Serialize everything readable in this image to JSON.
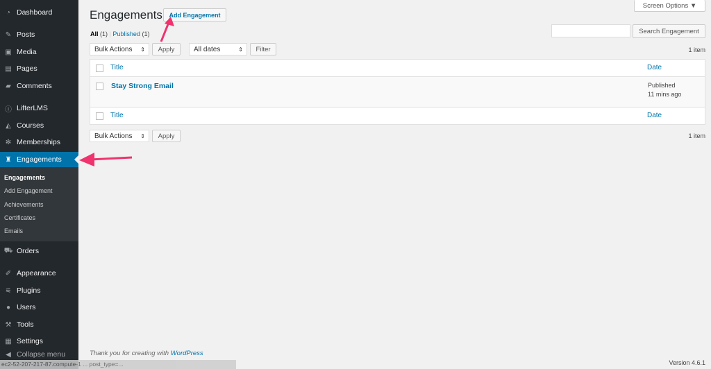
{
  "sidebar": {
    "items": [
      {
        "label": "Dashboard",
        "icon": "dashboard-icon"
      },
      {
        "label": "Posts",
        "icon": "pin-icon"
      },
      {
        "label": "Media",
        "icon": "media-icon"
      },
      {
        "label": "Pages",
        "icon": "pages-icon"
      },
      {
        "label": "Comments",
        "icon": "comment-icon"
      },
      {
        "label": "LifterLMS",
        "icon": "lifterlms-icon"
      },
      {
        "label": "Courses",
        "icon": "graduation-cap-icon"
      },
      {
        "label": "Memberships",
        "icon": "group-icon"
      },
      {
        "label": "Engagements",
        "icon": "award-icon"
      },
      {
        "label": "Orders",
        "icon": "cart-icon"
      },
      {
        "label": "Appearance",
        "icon": "brush-icon"
      },
      {
        "label": "Plugins",
        "icon": "plugin-icon"
      },
      {
        "label": "Users",
        "icon": "user-icon"
      },
      {
        "label": "Tools",
        "icon": "wrench-icon"
      },
      {
        "label": "Settings",
        "icon": "settings-icon"
      },
      {
        "label": "Collapse menu",
        "icon": "collapse-icon"
      }
    ],
    "submenu": [
      "Engagements",
      "Add Engagement",
      "Achievements",
      "Certificates",
      "Emails"
    ]
  },
  "header": {
    "title": "Engagements",
    "add_label": "Add Engagement",
    "screen_options": "Screen Options"
  },
  "filters": {
    "all": "All",
    "all_count": "(1)",
    "sep": "|",
    "published": "Published",
    "published_count": "(1)",
    "bulk": "Bulk Actions",
    "apply": "Apply",
    "dates": "All dates",
    "filter": "Filter",
    "item_count": "1 item",
    "search_button": "Search Engagement",
    "search_value": ""
  },
  "table": {
    "col_title": "Title",
    "col_date": "Date",
    "rows": [
      {
        "title": "Stay Strong Email",
        "status": "Published",
        "time": "11 mins ago"
      }
    ]
  },
  "footer": {
    "thanks": "Thank you for creating with ",
    "wp": "WordPress",
    "version": "Version 4.6.1",
    "status_url": "ec2-52-207-217-87.compute-1 ... post_type=..."
  },
  "colors": {
    "accent": "#0073aa",
    "sidebar": "#23282d",
    "arrow": "#f0326e"
  }
}
